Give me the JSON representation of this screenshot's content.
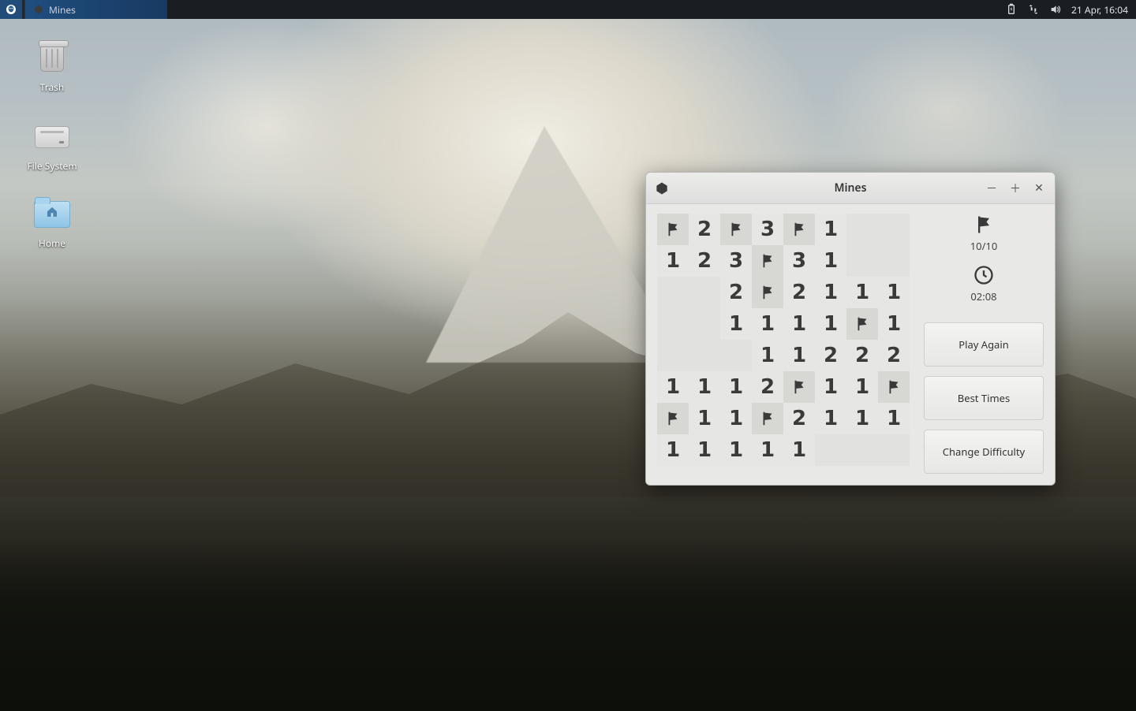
{
  "taskbar": {
    "active_app": "Mines",
    "clock": "21 Apr, 16:04"
  },
  "desktop_icons": {
    "trash": "Trash",
    "filesystem": "File System",
    "home": "Home"
  },
  "mines": {
    "title": "Mines",
    "flag_counter": "10/10",
    "timer": "02:08",
    "buttons": {
      "play_again": "Play Again",
      "best_times": "Best Times",
      "change_difficulty": "Change Difficulty"
    },
    "board": [
      [
        "F",
        "2",
        "F",
        "3",
        "F",
        "1",
        "",
        ""
      ],
      [
        "1",
        "2",
        "3",
        "F",
        "3",
        "1",
        "",
        ""
      ],
      [
        "",
        "",
        "2",
        "F",
        "2",
        "1",
        "1",
        "1"
      ],
      [
        "",
        "",
        "1",
        "1",
        "1",
        "1",
        "F",
        "1"
      ],
      [
        "",
        "",
        "",
        "1",
        "1",
        "2",
        "2",
        "2"
      ],
      [
        "1",
        "1",
        "1",
        "2",
        "F",
        "1",
        "1",
        "F"
      ],
      [
        "F",
        "1",
        "1",
        "F",
        "2",
        "1",
        "1",
        "1"
      ],
      [
        "1",
        "1",
        "1",
        "1",
        "1",
        "",
        "",
        ""
      ]
    ]
  }
}
